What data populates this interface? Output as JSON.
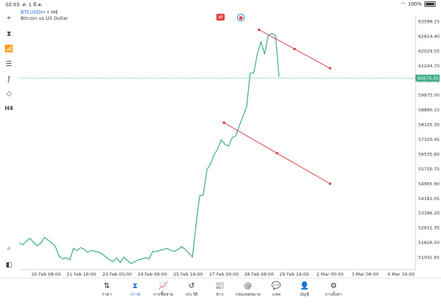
{
  "status_bar": {
    "time": "02:03",
    "date": "ศ. 1 มี.ค.",
    "battery": "100%",
    "wifi_icon": "wifi-icon",
    "battery_icon": "battery-icon"
  },
  "symbol": {
    "name": "BTCUSDm",
    "separator": " • ",
    "timeframe": "H4",
    "description": "Bitcoin vs US Dollar"
  },
  "left_toolbar": [
    {
      "name": "crosshair-icon",
      "glyph": "⌖"
    },
    {
      "name": "candles-icon",
      "glyph": "⧗"
    },
    {
      "name": "indicators-icon",
      "glyph": "📶"
    },
    {
      "name": "settings-sliders-icon",
      "glyph": "☰"
    },
    {
      "name": "function-icon",
      "glyph": "ƒ"
    },
    {
      "name": "shapes-icon",
      "glyph": "◇"
    },
    {
      "name": "timeframe-label",
      "glyph": "H4"
    }
  ],
  "price_scale": [
    "63599.25",
    "62814.40",
    "62029.55",
    "61244.70",
    "60459.85",
    "59675.00",
    "58890.15",
    "58105.30",
    "57320.45",
    "56535.60",
    "55750.75",
    "54965.90",
    "54181.05",
    "53396.20",
    "52611.35",
    "51826.50",
    "51041.65"
  ],
  "current_price": "60575.01",
  "time_scale": [
    "20 Feb 08:00",
    "21 Feb 16:00",
    "23 Feb 00:00",
    "24 Feb 08:00",
    "25 Feb 16:00",
    "27 Feb 00:00",
    "28 Feb 08:00",
    "29 Feb 16:00",
    "2 Mar 00:00",
    "3 Mar 08:00",
    "4 Mar 16:00"
  ],
  "chart_data": {
    "type": "line",
    "title": "BTCUSDm • H4",
    "subtitle": "Bitcoin vs US Dollar",
    "ylim": [
      50700,
      63900
    ],
    "x_ticks": [
      "20 Feb 08:00",
      "21 Feb 16:00",
      "23 Feb 00:00",
      "24 Feb 08:00",
      "25 Feb 16:00",
      "27 Feb 00:00",
      "28 Feb 08:00",
      "29 Feb 16:00",
      "2 Mar 00:00",
      "3 Mar 08:00",
      "4 Mar 16:00"
    ],
    "series": [
      {
        "name": "BTCUSDm",
        "values": [
          51800,
          51700,
          51900,
          52050,
          51800,
          51650,
          51800,
          52100,
          51950,
          51800,
          51600,
          51100,
          50950,
          51000,
          50900,
          51500,
          51400,
          51550,
          51450,
          51300,
          51400,
          51350,
          51300,
          51200,
          51050,
          50900,
          50800,
          51000,
          50750,
          51050,
          50850,
          50700,
          50800,
          50900,
          50950,
          51000,
          50950,
          51350,
          51350,
          51400,
          51450,
          51500,
          51400,
          51350,
          51450,
          51600,
          51450,
          51250,
          51050,
          52800,
          54300,
          54350,
          55700,
          56000,
          56500,
          56800,
          57300,
          57050,
          56950,
          57400,
          57500,
          58050,
          58550,
          59050,
          60850,
          60850,
          61900,
          62500,
          61850,
          62850,
          62950,
          62850,
          60650
        ]
      }
    ],
    "trendlines": [
      {
        "from": {
          "x": "28 Feb 08:00",
          "y": 63150
        },
        "to": {
          "x": "2 Mar 00:00",
          "y": 61100
        },
        "color": "#e0393e"
      },
      {
        "from": {
          "x": "27 Feb 00:00",
          "y": 58200
        },
        "to": {
          "x": "2 Mar 00:00",
          "y": 54950
        },
        "color": "#e0393e"
      }
    ],
    "current_price_line": 60575.01,
    "grid": false
  },
  "chart_buttons": [
    {
      "name": "one-click-trading-icon"
    },
    {
      "name": "signal-icon"
    }
  ],
  "bottom_nav": [
    {
      "label": "ราคา",
      "icon": "⇅",
      "name": "nav-quotes"
    },
    {
      "label": "กราฟ",
      "icon": "⧗",
      "name": "nav-chart"
    },
    {
      "label": "การซื้อขาย",
      "icon": "📈",
      "name": "nav-trade"
    },
    {
      "label": "ประวัติ",
      "icon": "↺",
      "name": "nav-history"
    },
    {
      "label": "ข่าว",
      "icon": "📰",
      "name": "nav-news"
    },
    {
      "label": "กล่องจดหมาย",
      "icon": "@",
      "name": "nav-mailbox"
    },
    {
      "label": "แชท",
      "icon": "💬",
      "name": "nav-chat"
    },
    {
      "label": "บัญชี",
      "icon": "👤",
      "name": "nav-accounts"
    },
    {
      "label": "การตั้งค่า",
      "icon": "⚙",
      "name": "nav-settings"
    }
  ],
  "active_nav": "กราฟ",
  "colors": {
    "line": "#3fae8c",
    "trend": "#e0393e",
    "price_tag": "#3fae8c",
    "accent": "#1e73e8"
  }
}
